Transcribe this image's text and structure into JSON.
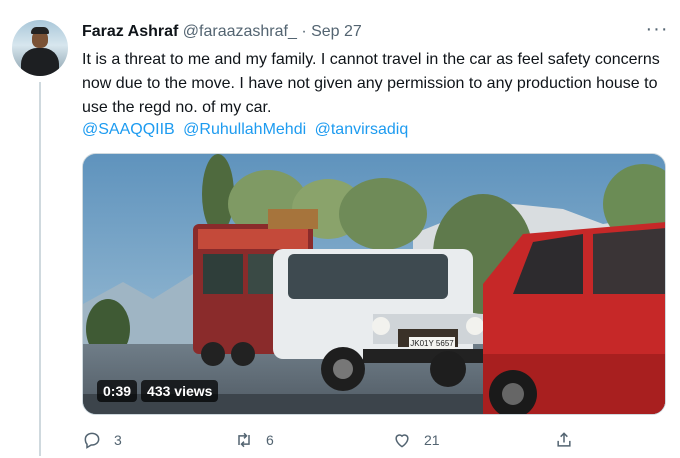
{
  "tweet": {
    "author_name": "Faraz Ashraf",
    "handle": "@faraazashraf_",
    "separator": "·",
    "date": "Sep 27",
    "more_label": "···",
    "text": "It is a threat to me and my family. I cannot travel in the car as feel safety concerns now due to the move. I have not given any permission to any production house to use the regd no. of my car.",
    "mentions": [
      "@SAAQQIIB",
      "@RuhullahMehdi",
      "@tanvirsadiq"
    ]
  },
  "media": {
    "duration": "0:39",
    "views": "433 views",
    "plate_text": "JK01Y 5657"
  },
  "actions": {
    "reply_count": "3",
    "retweet_count": "6",
    "like_count": "21"
  },
  "icons": [
    "reply-icon",
    "retweet-icon",
    "like-icon",
    "share-icon",
    "more-icon"
  ],
  "colors": {
    "link": "#1d9bf0",
    "muted": "#536471",
    "text": "#0f1419"
  }
}
